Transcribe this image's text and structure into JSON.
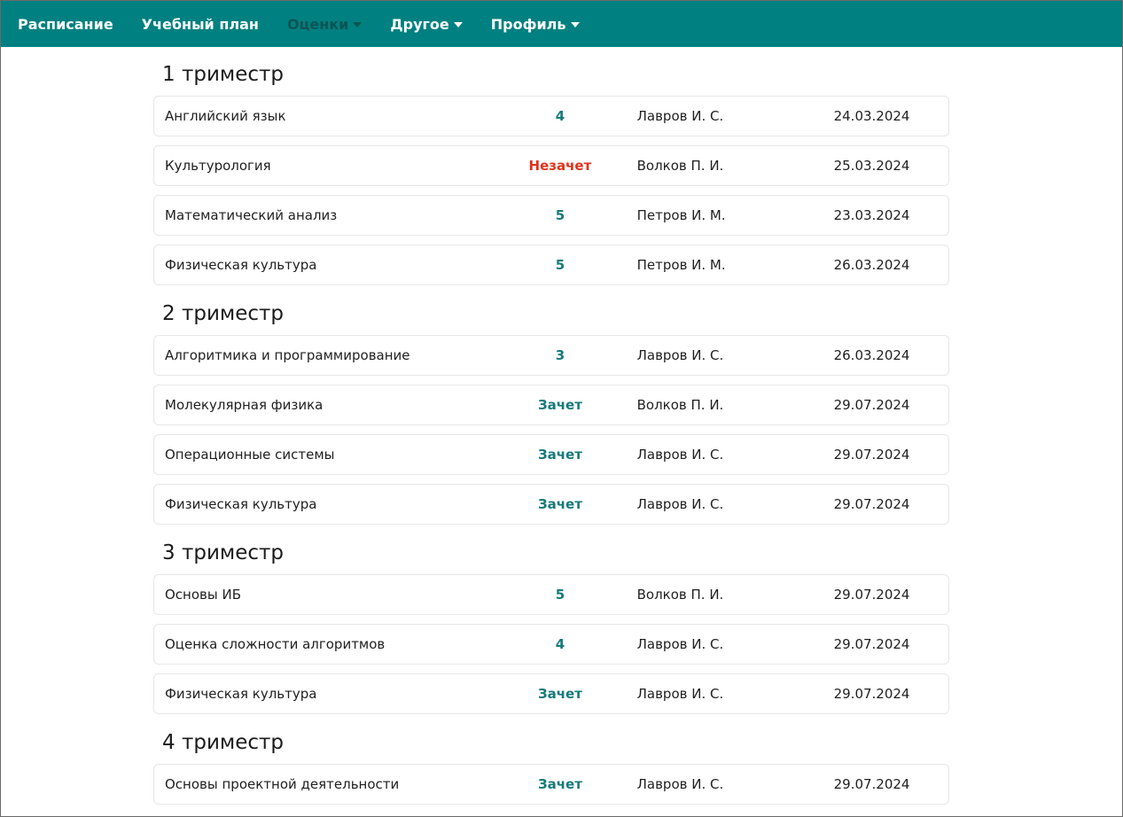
{
  "nav": {
    "items": [
      {
        "label": "Расписание",
        "dropdown": false,
        "active": false
      },
      {
        "label": "Учебный план",
        "dropdown": false,
        "active": false
      },
      {
        "label": "Оценки",
        "dropdown": true,
        "active": true
      },
      {
        "label": "Другое",
        "dropdown": true,
        "active": false
      },
      {
        "label": "Профиль",
        "dropdown": true,
        "active": false
      }
    ]
  },
  "colors": {
    "navbar": "#008080",
    "grade": "#177a7a",
    "fail": "#e0321c"
  },
  "terms": [
    {
      "title": "1 триместр",
      "rows": [
        {
          "subject": "Английский язык",
          "grade": "4",
          "teacher": "Лавров И. С.",
          "date": "24.03.2024",
          "fail": false
        },
        {
          "subject": "Культурология",
          "grade": "Незачет",
          "teacher": "Волков П. И.",
          "date": "25.03.2024",
          "fail": true
        },
        {
          "subject": "Математический анализ",
          "grade": "5",
          "teacher": "Петров И. М.",
          "date": "23.03.2024",
          "fail": false
        },
        {
          "subject": "Физическая культура",
          "grade": "5",
          "teacher": "Петров И. М.",
          "date": "26.03.2024",
          "fail": false
        }
      ]
    },
    {
      "title": "2 триместр",
      "rows": [
        {
          "subject": "Алгоритмика и программирование",
          "grade": "3",
          "teacher": "Лавров И. С.",
          "date": "26.03.2024",
          "fail": false
        },
        {
          "subject": "Молекулярная физика",
          "grade": "Зачет",
          "teacher": "Волков П. И.",
          "date": "29.07.2024",
          "fail": false
        },
        {
          "subject": "Операционные системы",
          "grade": "Зачет",
          "teacher": "Лавров И. С.",
          "date": "29.07.2024",
          "fail": false
        },
        {
          "subject": "Физическая культура",
          "grade": "Зачет",
          "teacher": "Лавров И. С.",
          "date": "29.07.2024",
          "fail": false
        }
      ]
    },
    {
      "title": "3 триместр",
      "rows": [
        {
          "subject": "Основы ИБ",
          "grade": "5",
          "teacher": "Волков П. И.",
          "date": "29.07.2024",
          "fail": false
        },
        {
          "subject": "Оценка сложности алгоритмов",
          "grade": "4",
          "teacher": "Лавров И. С.",
          "date": "29.07.2024",
          "fail": false
        },
        {
          "subject": "Физическая культура",
          "grade": "Зачет",
          "teacher": "Лавров И. С.",
          "date": "29.07.2024",
          "fail": false
        }
      ]
    },
    {
      "title": "4 триместр",
      "rows": [
        {
          "subject": "Основы проектной деятельности",
          "grade": "Зачет",
          "teacher": "Лавров И. С.",
          "date": "29.07.2024",
          "fail": false
        }
      ]
    }
  ]
}
